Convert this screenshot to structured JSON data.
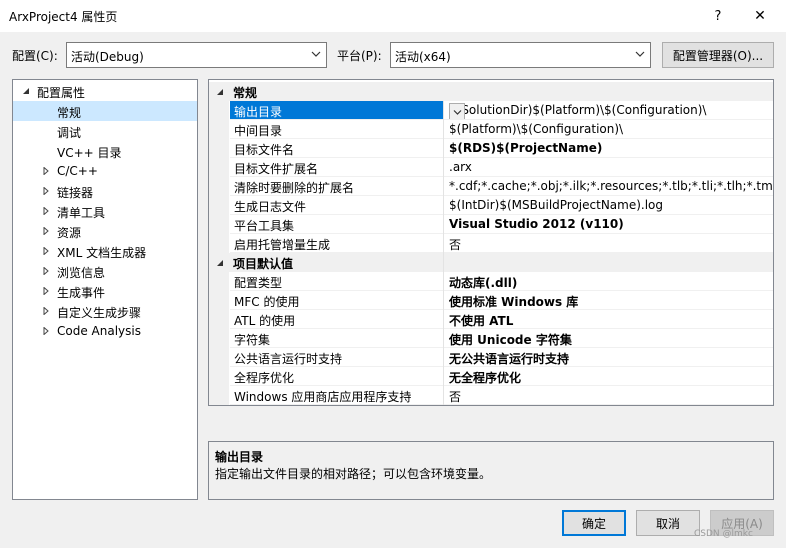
{
  "window": {
    "title": "ArxProject4 属性页",
    "help": "?",
    "close": "✕"
  },
  "config": {
    "label": "配置(C):",
    "value": "活动(Debug)"
  },
  "platform": {
    "label": "平台(P):",
    "value": "活动(x64)"
  },
  "config_manager_button": "配置管理器(O)...",
  "tree": {
    "root": "配置属性",
    "items": [
      {
        "label": "常规",
        "selected": true,
        "expandable": false
      },
      {
        "label": "调试",
        "expandable": false
      },
      {
        "label": "VC++ 目录",
        "expandable": false
      },
      {
        "label": "C/C++",
        "expandable": true
      },
      {
        "label": "链接器",
        "expandable": true
      },
      {
        "label": "清单工具",
        "expandable": true
      },
      {
        "label": "资源",
        "expandable": true
      },
      {
        "label": "XML 文档生成器",
        "expandable": true
      },
      {
        "label": "浏览信息",
        "expandable": true
      },
      {
        "label": "生成事件",
        "expandable": true
      },
      {
        "label": "自定义生成步骤",
        "expandable": true
      },
      {
        "label": "Code Analysis",
        "expandable": true
      }
    ]
  },
  "grid": {
    "categories": [
      {
        "name": "常规",
        "rows": [
          {
            "name": "输出目录",
            "value": "$(SolutionDir)$(Platform)\\$(Configuration)\\",
            "bold": false,
            "selected": true
          },
          {
            "name": "中间目录",
            "value": "$(Platform)\\$(Configuration)\\",
            "bold": false
          },
          {
            "name": "目标文件名",
            "value": "$(RDS)$(ProjectName)",
            "bold": true
          },
          {
            "name": "目标文件扩展名",
            "value": ".arx",
            "bold": false
          },
          {
            "name": "清除时要删除的扩展名",
            "value": "*.cdf;*.cache;*.obj;*.ilk;*.resources;*.tlb;*.tli;*.tlh;*.tmp;*.rsp",
            "bold": false
          },
          {
            "name": "生成日志文件",
            "value": "$(IntDir)$(MSBuildProjectName).log",
            "bold": false
          },
          {
            "name": "平台工具集",
            "value": "Visual Studio 2012 (v110)",
            "bold": true
          },
          {
            "name": "启用托管增量生成",
            "value": "否",
            "bold": false
          }
        ]
      },
      {
        "name": "项目默认值",
        "rows": [
          {
            "name": "配置类型",
            "value": "动态库(.dll)",
            "bold": true
          },
          {
            "name": "MFC 的使用",
            "value": "使用标准 Windows 库",
            "bold": true
          },
          {
            "name": "ATL 的使用",
            "value": "不使用 ATL",
            "bold": true
          },
          {
            "name": "字符集",
            "value": "使用 Unicode 字符集",
            "bold": true
          },
          {
            "name": "公共语言运行时支持",
            "value": "无公共语言运行时支持",
            "bold": true
          },
          {
            "name": "全程序优化",
            "value": "无全程序优化",
            "bold": true
          },
          {
            "name": "Windows 应用商店应用程序支持",
            "value": "否",
            "bold": false
          }
        ]
      }
    ]
  },
  "description": {
    "title": "输出目录",
    "text": "指定输出文件目录的相对路径；可以包含环境变量。"
  },
  "buttons": {
    "ok": "确定",
    "cancel": "取消",
    "apply": "应用(A)"
  },
  "watermark": "CSDN @lmkc"
}
